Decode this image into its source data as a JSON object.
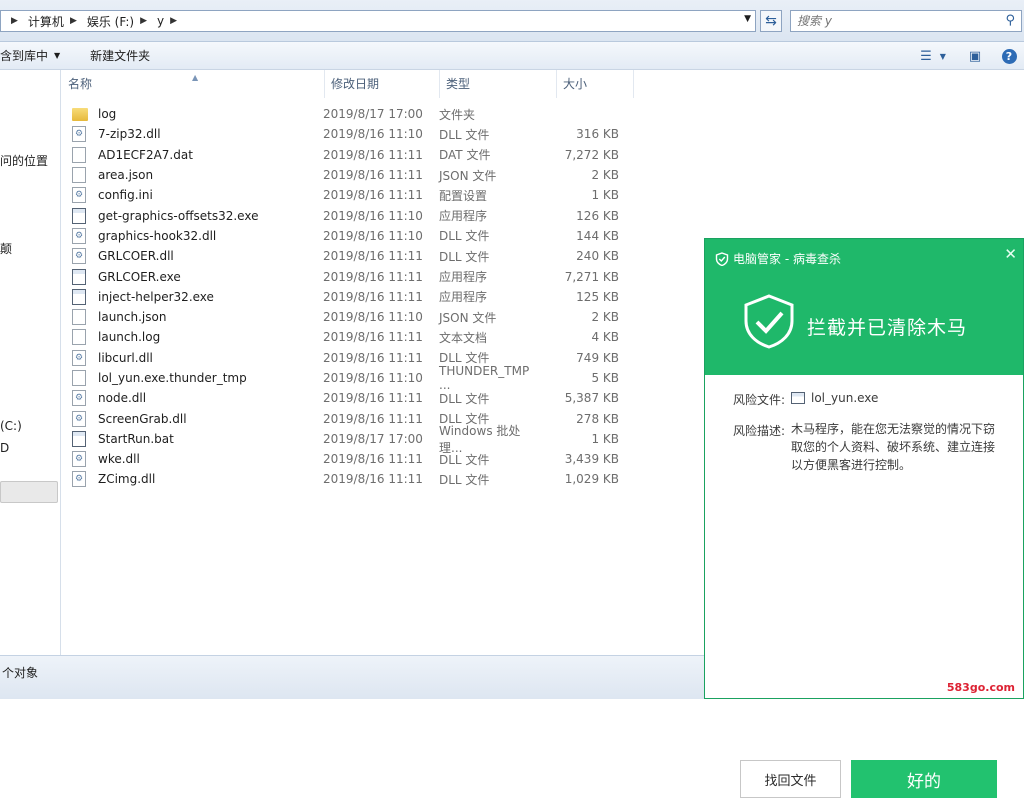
{
  "address": {
    "crumbs": [
      "计算机",
      "娱乐 (F:)",
      "y"
    ],
    "search_placeholder": "搜索 y"
  },
  "toolbar": {
    "include_library": "含到库中",
    "new_folder": "新建文件夹"
  },
  "sidebar": {
    "items": [
      "问的位置",
      "颠",
      "(C:)",
      "D"
    ]
  },
  "columns": {
    "name": "名称",
    "date": "修改日期",
    "type": "类型",
    "size": "大小"
  },
  "files": [
    {
      "name": "log",
      "date": "2019/8/17 17:00",
      "type": "文件夹",
      "size": "",
      "icon": "folder-icon"
    },
    {
      "name": "7-zip32.dll",
      "date": "2019/8/16 11:10",
      "type": "DLL 文件",
      "size": "316 KB",
      "icon": "dll-file-icon"
    },
    {
      "name": "AD1ECF2A7.dat",
      "date": "2019/8/16 11:11",
      "type": "DAT 文件",
      "size": "7,272 KB",
      "icon": "dat-file-icon"
    },
    {
      "name": "area.json",
      "date": "2019/8/16 11:11",
      "type": "JSON 文件",
      "size": "2 KB",
      "icon": "document-icon"
    },
    {
      "name": "config.ini",
      "date": "2019/8/16 11:11",
      "type": "配置设置",
      "size": "1 KB",
      "icon": "config-file-icon"
    },
    {
      "name": "get-graphics-offsets32.exe",
      "date": "2019/8/16 11:10",
      "type": "应用程序",
      "size": "126 KB",
      "icon": "exe-file-icon"
    },
    {
      "name": "graphics-hook32.dll",
      "date": "2019/8/16 11:10",
      "type": "DLL 文件",
      "size": "144 KB",
      "icon": "dll-file-icon"
    },
    {
      "name": "GRLCOER.dll",
      "date": "2019/8/16 11:11",
      "type": "DLL 文件",
      "size": "240 KB",
      "icon": "dll-file-icon"
    },
    {
      "name": "GRLCOER.exe",
      "date": "2019/8/16 11:11",
      "type": "应用程序",
      "size": "7,271 KB",
      "icon": "exe-file-icon"
    },
    {
      "name": "inject-helper32.exe",
      "date": "2019/8/16 11:11",
      "type": "应用程序",
      "size": "125 KB",
      "icon": "exe-file-icon"
    },
    {
      "name": "launch.json",
      "date": "2019/8/16 11:10",
      "type": "JSON 文件",
      "size": "2 KB",
      "icon": "document-icon"
    },
    {
      "name": "launch.log",
      "date": "2019/8/16 11:11",
      "type": "文本文档",
      "size": "4 KB",
      "icon": "document-icon"
    },
    {
      "name": "libcurl.dll",
      "date": "2019/8/16 11:11",
      "type": "DLL 文件",
      "size": "749 KB",
      "icon": "dll-file-icon"
    },
    {
      "name": "lol_yun.exe.thunder_tmp",
      "date": "2019/8/16 11:10",
      "type": "THUNDER_TMP ...",
      "size": "5 KB",
      "icon": "document-icon"
    },
    {
      "name": "node.dll",
      "date": "2019/8/16 11:11",
      "type": "DLL 文件",
      "size": "5,387 KB",
      "icon": "dll-file-icon"
    },
    {
      "name": "ScreenGrab.dll",
      "date": "2019/8/16 11:11",
      "type": "DLL 文件",
      "size": "278 KB",
      "icon": "dll-file-icon"
    },
    {
      "name": "StartRun.bat",
      "date": "2019/8/17 17:00",
      "type": "Windows 批处理...",
      "size": "1 KB",
      "icon": "bat-file-icon"
    },
    {
      "name": "wke.dll",
      "date": "2019/8/16 11:11",
      "type": "DLL 文件",
      "size": "3,439 KB",
      "icon": "dll-file-icon"
    },
    {
      "name": "ZCimg.dll",
      "date": "2019/8/16 11:11",
      "type": "DLL 文件",
      "size": "1,029 KB",
      "icon": "dll-file-icon"
    }
  ],
  "status": {
    "text": "个对象"
  },
  "popup": {
    "title": "电脑管家 - 病毒查杀",
    "message": "拦截并已清除木马",
    "file_label": "风险文件:",
    "file_value": "lol_yun.exe",
    "desc_label": "风险描述:",
    "desc_value": "木马程序，能在您无法察觉的情况下窃取您的个人资料、破坏系统、建立连接以方便黑客进行控制。",
    "btn_find": "找回文件",
    "btn_ok": "好的",
    "accent": "#1fb86a"
  },
  "watermark": "583go.com"
}
